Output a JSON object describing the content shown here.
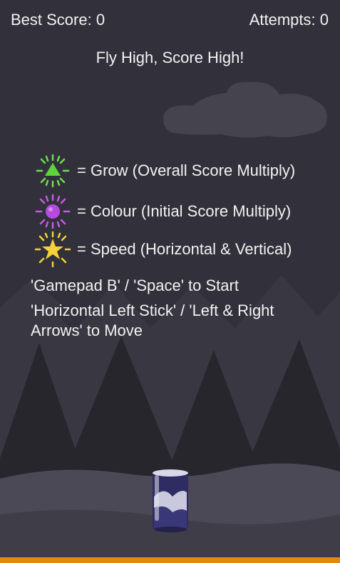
{
  "hud": {
    "best_score": "Best Score: 0",
    "attempts": "Attempts: 0"
  },
  "tagline": "Fly High, Score High!",
  "legend": [
    {
      "icon": "grow-powerup-icon",
      "color": "#6ee04a",
      "text": "= Grow (Overall Score Multiply)"
    },
    {
      "icon": "colour-powerup-icon",
      "color": "#c85ae8",
      "text": "= Colour (Initial Score Multiply)"
    },
    {
      "icon": "speed-powerup-icon",
      "color": "#f2d23c",
      "text": "= Speed (Horizontal & Vertical)"
    }
  ],
  "instructions": {
    "start": "'Gamepad B' / 'Space' to Start",
    "move": "'Horizontal Left Stick' / 'Left & Right Arrows' to Move"
  },
  "colors": {
    "sky": "#32313b",
    "ground_bar": "#e08a0f"
  }
}
